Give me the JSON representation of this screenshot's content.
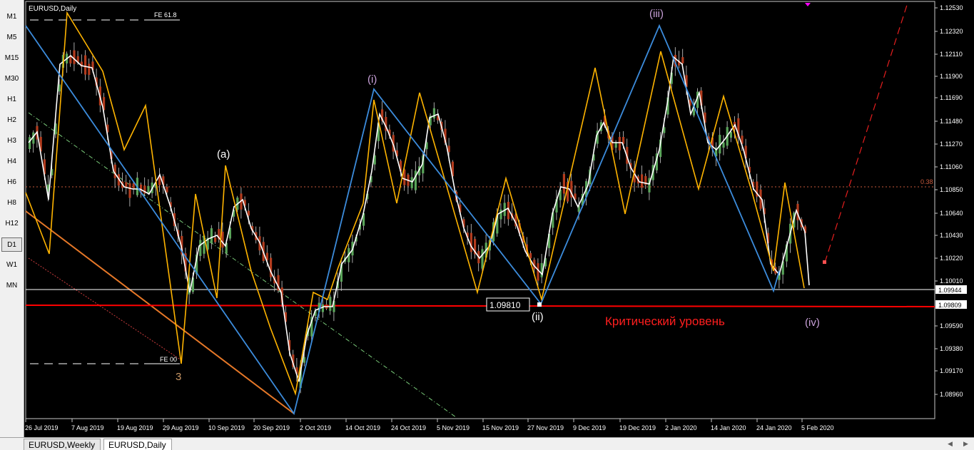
{
  "chart": {
    "title": "EURUSD,Daily",
    "fe_top": "FE 61.8",
    "fe_bottom": "FE 00",
    "level_38": "0.38",
    "critical_level_label": "Критический уровень",
    "price_box": "1.09810",
    "current_price": "1.09944",
    "critical_price": "1.09809"
  },
  "timeframes": [
    "M1",
    "M5",
    "M15",
    "M30",
    "H1",
    "H2",
    "H3",
    "H4",
    "H6",
    "H8",
    "H12",
    "D1",
    "W1",
    "MN"
  ],
  "active_timeframe": "D1",
  "price_axis": [
    "1.12530",
    "1.12320",
    "1.12110",
    "1.11900",
    "1.11690",
    "1.11480",
    "1.11270",
    "1.11060",
    "1.10850",
    "1.10640",
    "1.10430",
    "1.10220",
    "1.10010",
    "1.09590",
    "1.09380",
    "1.09170",
    "1.08960"
  ],
  "date_axis": [
    "26 Jul 2019",
    "7 Aug 2019",
    "19 Aug 2019",
    "29 Aug 2019",
    "10 Sep 2019",
    "20 Sep 2019",
    "2 Oct 2019",
    "14 Oct 2019",
    "24 Oct 2019",
    "5 Nov 2019",
    "15 Nov 2019",
    "27 Nov 2019",
    "9 Dec 2019",
    "19 Dec 2019",
    "2 Jan 2020",
    "14 Jan 2020",
    "24 Jan 2020",
    "5 Feb 2020"
  ],
  "wave_labels": {
    "a": "(a)",
    "i": "(i)",
    "ii": "(ii)",
    "iii": "(iii)",
    "iv": "(iv)",
    "three": "3"
  },
  "tabs": [
    "EURUSD,Weekly",
    "EURUSD,Daily"
  ],
  "active_tab": "EURUSD,Daily",
  "colors": {
    "bull": "#5aa55a",
    "bear": "#b43c1e",
    "blue_zigzag": "#3c8cdc",
    "yellow_zigzag": "#ffb400",
    "critical_line": "#ff0000",
    "critical_text": "#ff1e1e",
    "wave_label": "#c8a0d8"
  }
}
